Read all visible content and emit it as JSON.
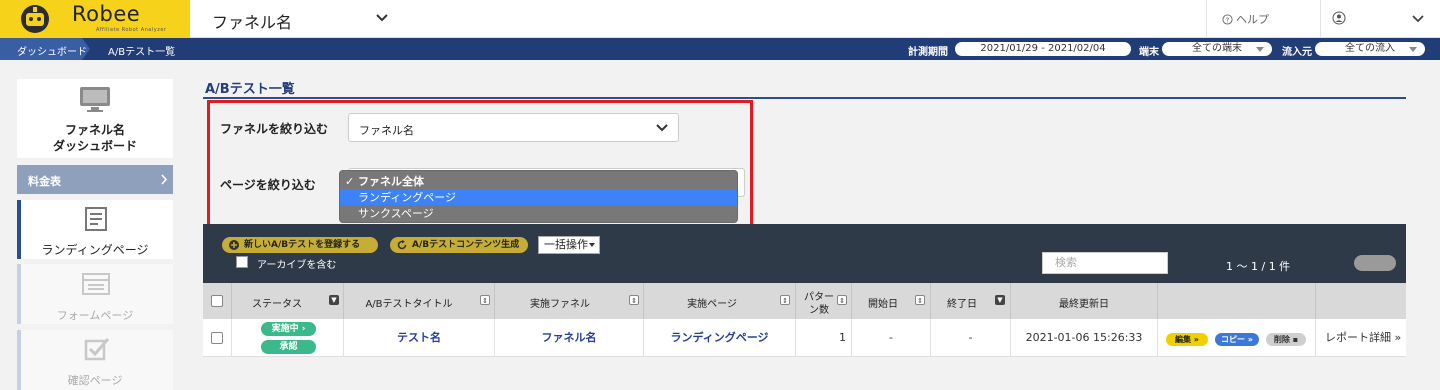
{
  "app": {
    "logo_text": "Robee",
    "logo_subtext": "Affiliate Robot Analyzer",
    "funnel_name": "ファネル名",
    "help_label": "ヘルプ"
  },
  "nav": {
    "breadcrumb_home": "ダッシュボード",
    "breadcrumb_current": "A/Bテスト一覧",
    "period_label": "計測期間",
    "period_value": "2021/01/29 - 2021/02/04",
    "device_label": "端末",
    "device_value": "全ての端末",
    "source_label": "流入元",
    "source_value": "全ての流入"
  },
  "sidebar": {
    "dashboard_line1": "ファネル名",
    "dashboard_line2": "ダッシュボード",
    "plan_label": "料金表",
    "items": [
      {
        "label": "ランディングページ"
      },
      {
        "label": "フォームページ"
      },
      {
        "label": "確認ページ"
      }
    ]
  },
  "main": {
    "title": "A/Bテスト一覧",
    "filter_funnel_label": "ファネルを絞り込む",
    "filter_funnel_value": "ファネル名",
    "filter_page_label": "ページを絞り込む",
    "page_options": [
      "ファネル全体",
      "ランディングページ",
      "サンクスページ"
    ],
    "page_selected_index": 0,
    "page_highlight_index": 1
  },
  "toolbar": {
    "new_test_label": "新しいA/Bテストを登録する",
    "gen_content_label": "A/Bテストコンテンツ生成",
    "bulk_label": "一括操作",
    "archive_label": "アーカイブを含む",
    "search_placeholder": "検索",
    "pager_text": "1 〜 1 / 1 件"
  },
  "table": {
    "headers": {
      "status": "ステータス",
      "title": "A/Bテストタイトル",
      "funnel": "実施ファネル",
      "page": "実施ページ",
      "patterns_line1": "パター",
      "patterns_line2": "ン数",
      "start": "開始日",
      "end": "終了日",
      "updated": "最終更新日"
    },
    "rows": [
      {
        "status_running": "実施中",
        "status_approved": "承認",
        "title": "テスト名",
        "funnel": "ファネル名",
        "page": "ランディングページ",
        "patterns": "1",
        "start": "-",
        "end": "-",
        "updated": "2021-01-06 15:26:33",
        "edit_label": "編集",
        "copy_label": "コピー",
        "delete_label": "削除",
        "report_label": "レポート詳細"
      }
    ]
  }
}
